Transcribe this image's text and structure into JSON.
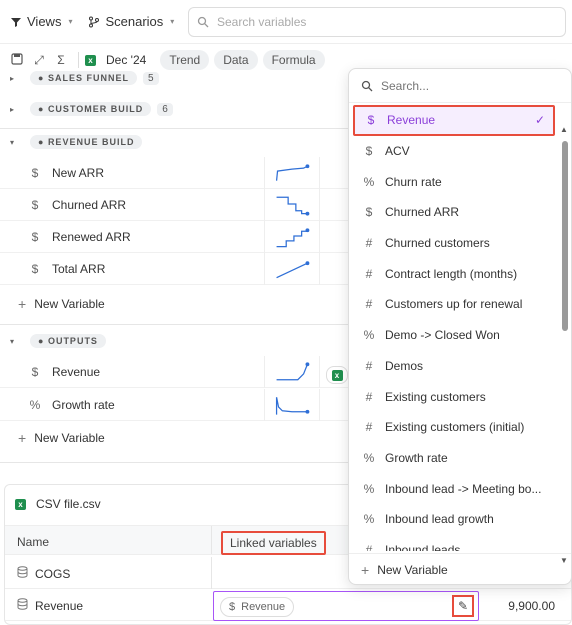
{
  "topbar": {
    "views_label": "Views",
    "scenarios_label": "Scenarios",
    "search_placeholder": "Search variables"
  },
  "toolbar": {
    "date": "Dec '24",
    "tabs": [
      "Trend",
      "Data",
      "Formula"
    ]
  },
  "groups": [
    {
      "name": "SALES FUNNEL",
      "count": "5",
      "expanded": false
    },
    {
      "name": "CUSTOMER BUILD",
      "count": "6",
      "expanded": false
    },
    {
      "name": "REVENUE BUILD",
      "expanded": true
    },
    {
      "name": "OUTPUTS",
      "expanded": true
    }
  ],
  "revenue_build_vars": [
    {
      "icon": "dollar-icon",
      "name": "New ARR"
    },
    {
      "icon": "dollar-icon",
      "name": "Churned ARR"
    },
    {
      "icon": "dollar-icon",
      "name": "Renewed ARR"
    },
    {
      "icon": "dollar-icon",
      "name": "Total ARR"
    }
  ],
  "outputs_vars": [
    {
      "icon": "dollar-icon",
      "name": "Revenue"
    },
    {
      "icon": "percent-icon",
      "name": "Growth rate"
    }
  ],
  "new_variable_label": "New Variable",
  "csv": {
    "file_name": "CSV file.csv",
    "col_name": "Name",
    "col_linked": "Linked variables",
    "rows": [
      {
        "name": "COGS",
        "linked": "",
        "value": ""
      },
      {
        "name": "Revenue",
        "linked": "Revenue",
        "value": "9,900.00"
      }
    ]
  },
  "dropdown": {
    "search_placeholder": "Search...",
    "items": [
      {
        "icon": "$",
        "label": "Revenue",
        "selected": true
      },
      {
        "icon": "$",
        "label": "ACV"
      },
      {
        "icon": "%",
        "label": "Churn rate"
      },
      {
        "icon": "$",
        "label": "Churned ARR"
      },
      {
        "icon": "#",
        "label": "Churned customers"
      },
      {
        "icon": "#",
        "label": "Contract length (months)"
      },
      {
        "icon": "#",
        "label": "Customers up for renewal"
      },
      {
        "icon": "%",
        "label": "Demo -> Closed Won"
      },
      {
        "icon": "#",
        "label": "Demos"
      },
      {
        "icon": "#",
        "label": "Existing customers"
      },
      {
        "icon": "#",
        "label": "Existing customers (initial)"
      },
      {
        "icon": "%",
        "label": "Growth rate"
      },
      {
        "icon": "%",
        "label": "Inbound lead -> Meeting bo..."
      },
      {
        "icon": "%",
        "label": "Inbound lead growth"
      },
      {
        "icon": "#",
        "label": "Inbound leads"
      }
    ],
    "footer_label": "New Variable"
  },
  "colors": {
    "accent": "#8b3fd9",
    "highlight": "#e74c3c",
    "spark": "#2f6fd6",
    "excel": "#1f8f4e"
  }
}
